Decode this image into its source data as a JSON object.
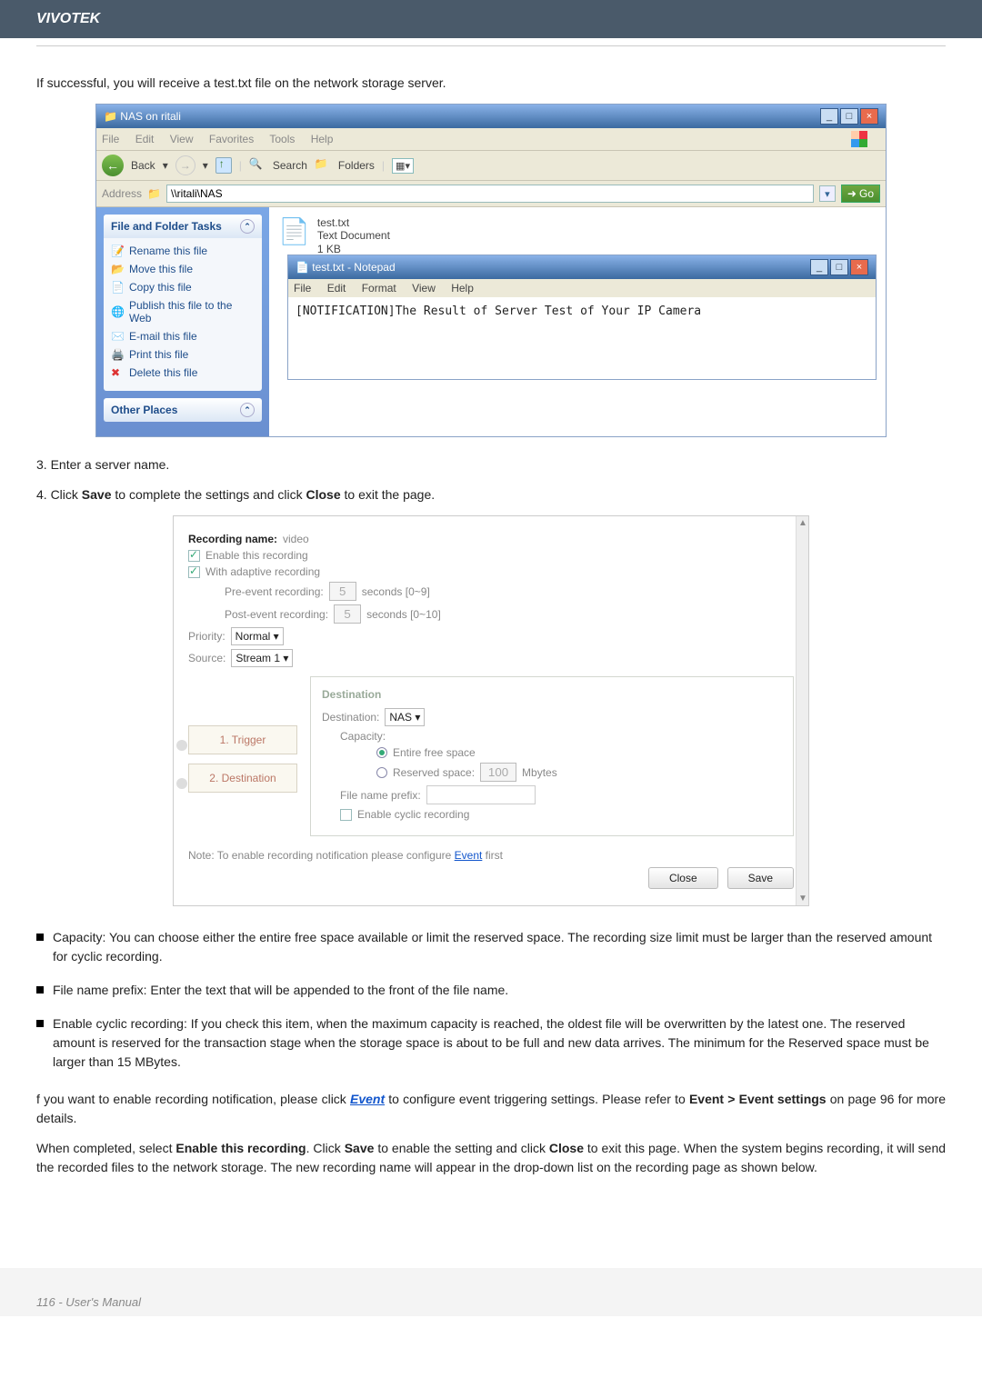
{
  "header": {
    "brand": "VIVOTEK"
  },
  "intro_text": "If successful, you will receive a test.txt file on the network storage server.",
  "explorer": {
    "title": "NAS on ritali",
    "menu": [
      "File",
      "Edit",
      "View",
      "Favorites",
      "Tools",
      "Help"
    ],
    "toolbar": {
      "back": "Back",
      "search": "Search",
      "folders": "Folders"
    },
    "address_label": "Address",
    "address_value": "\\\\ritali\\NAS",
    "go": "Go",
    "panel_tasks_title": "File and Folder Tasks",
    "tasks": [
      {
        "icon": "📝",
        "label": "Rename this file"
      },
      {
        "icon": "📂",
        "label": "Move this file"
      },
      {
        "icon": "📄",
        "label": "Copy this file"
      },
      {
        "icon": "🌐",
        "label": "Publish this file to the Web"
      },
      {
        "icon": "✉️",
        "label": "E-mail this file"
      },
      {
        "icon": "🖨️",
        "label": "Print this file"
      },
      {
        "icon": "✖",
        "label": "Delete this file"
      }
    ],
    "panel_other_title": "Other Places",
    "file": {
      "name": "test.txt",
      "type": "Text Document",
      "size": "1 KB"
    }
  },
  "notepad": {
    "title": "test.txt - Notepad",
    "menu": [
      "File",
      "Edit",
      "Format",
      "View",
      "Help"
    ],
    "content": "[NOTIFICATION]The Result of Server Test of Your IP Camera"
  },
  "steps": {
    "s3": "3. Enter a server name.",
    "s4_a": "4. Click ",
    "s4_b": "Save",
    "s4_c": " to complete the settings and click ",
    "s4_d": "Close",
    "s4_e": " to exit the page."
  },
  "rec": {
    "name_label": "Recording name:",
    "name_value": "video",
    "enable": "Enable this recording",
    "adaptive": "With adaptive recording",
    "pre_label": "Pre-event recording:",
    "pre_val": "5",
    "pre_hint": "seconds [0~9]",
    "post_label": "Post-event recording:",
    "post_val": "5",
    "post_hint": "seconds [0~10]",
    "priority_label": "Priority:",
    "priority_val": "Normal",
    "source_label": "Source:",
    "source_val": "Stream 1",
    "step1": "1. Trigger",
    "step2": "2. Destination",
    "dest_title": "Destination",
    "dest_label": "Destination:",
    "dest_val": "NAS",
    "capacity_label": "Capacity:",
    "entire": "Entire free space",
    "reserved": "Reserved space:",
    "reserved_val": "100",
    "reserved_unit": "Mbytes",
    "prefix_label": "File name prefix:",
    "cyclic": "Enable cyclic recording",
    "note_a": "Note: To enable recording notification please configure ",
    "note_link": "Event",
    "note_b": " first",
    "close_btn": "Close",
    "save_btn": "Save"
  },
  "bullets": {
    "b1": "Capacity: You can choose either the entire free space available or limit the reserved space. The recording size limit must be larger than the reserved amount for cyclic recording.",
    "b2": "File name prefix: Enter the text that will be appended to the front of the file name.",
    "b3": "Enable cyclic recording: If you check this item, when the maximum capacity is reached, the oldest file will be overwritten by the latest one. The reserved amount is reserved for the transaction stage when the storage space is about to be full and new data arrives. The minimum for the Reserved space must be larger than 15 MBytes."
  },
  "para_event_a": "f you want to enable recording notification, please click ",
  "para_event_link": "Event",
  "para_event_b": " to configure event triggering settings. Please refer to ",
  "para_event_c": "Event > Event settings",
  "para_event_d": " on page 96 for more details.",
  "para_final_a": "When completed, select ",
  "para_final_b": "Enable this recording",
  "para_final_c": ". Click ",
  "para_final_d": "Save",
  "para_final_e": " to enable the setting and click ",
  "para_final_f": "Close",
  "para_final_g": " to exit this page. When the system begins recording, it will send the recorded files to the network storage. The new recording name will appear in the drop-down list on the recording page as shown below.",
  "footer": "116 - User's Manual"
}
